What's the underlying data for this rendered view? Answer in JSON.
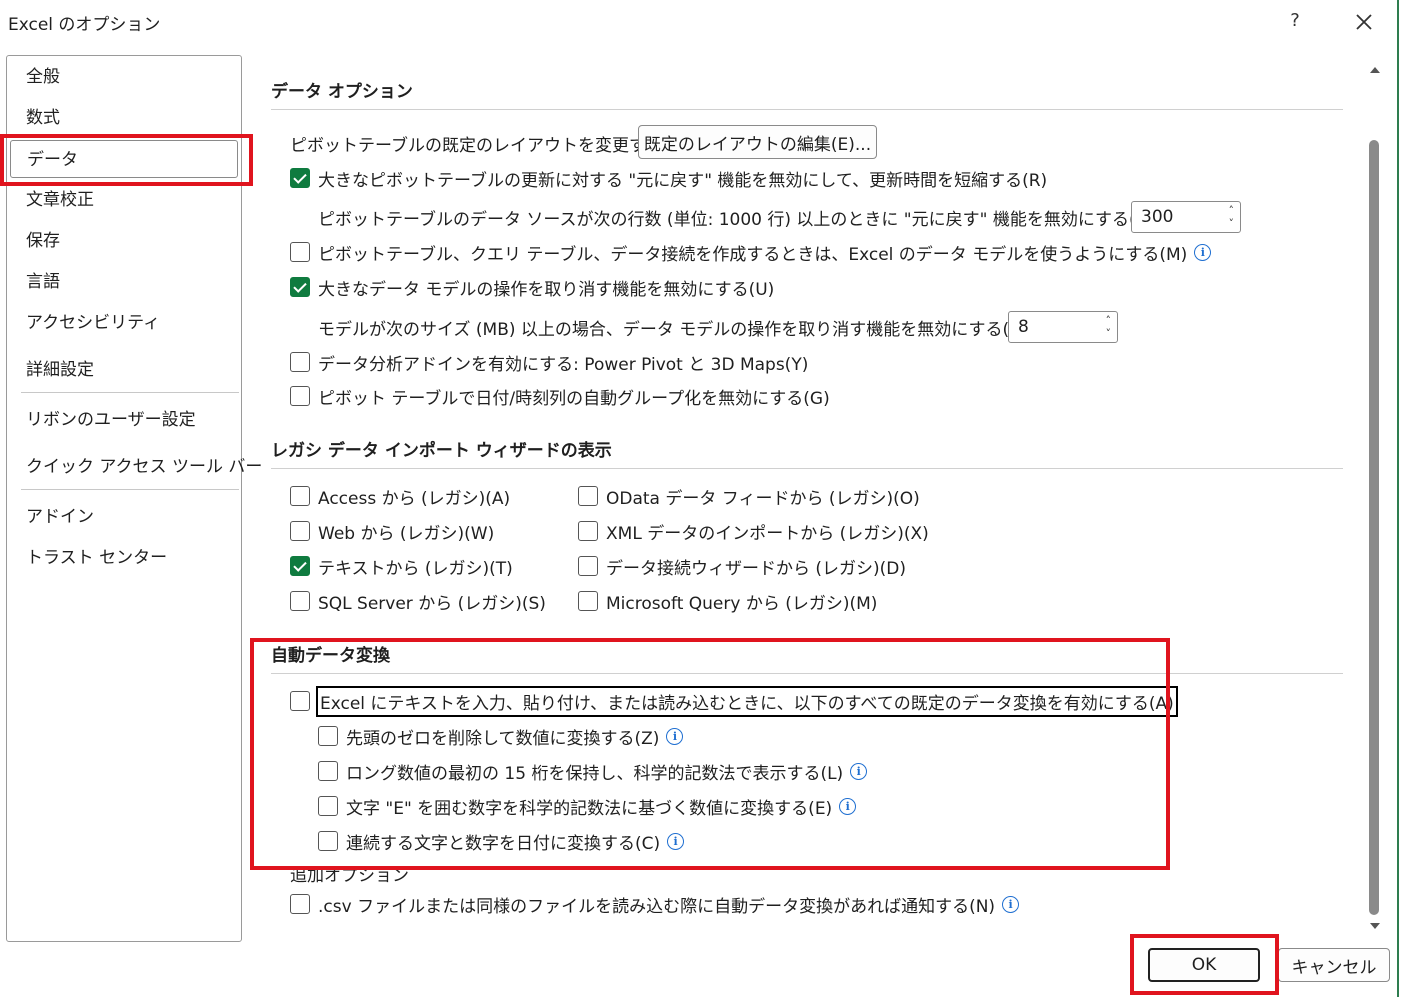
{
  "window": {
    "title": "Excel のオプション",
    "help": "?"
  },
  "sidebar": {
    "items": [
      {
        "label": "全般"
      },
      {
        "label": "数式"
      },
      {
        "label": "データ"
      },
      {
        "label": "文章校正"
      },
      {
        "label": "保存"
      },
      {
        "label": "言語"
      },
      {
        "label": "アクセシビリティ"
      },
      {
        "label": "詳細設定"
      },
      {
        "label": "リボンのユーザー設定"
      },
      {
        "label": "クイック アクセス ツール バー"
      },
      {
        "label": "アドイン"
      },
      {
        "label": "トラスト センター"
      }
    ],
    "selected": "データ"
  },
  "data_options": {
    "title": "データ オプション",
    "pivot_layout_label": "ピボットテーブルの既定のレイアウトを変更する:",
    "pivot_layout_button": "既定のレイアウトの編集(E)...",
    "undo_large_pivot": {
      "label": "大きなピボットテーブルの更新に対する \"元に戻す\" 機能を無効にして、更新時間を短縮する(R)",
      "checked": true
    },
    "undo_rows_label": "ピボットテーブルのデータ ソースが次の行数 (単位: 1000 行) 以上のときに \"元に戻す\" 機能を無効にする(N):",
    "undo_rows_value": "300",
    "use_data_model": {
      "label": "ピボットテーブル、クエリ テーブル、データ接続を作成するときは、Excel のデータ モデルを使うようにする(M)",
      "checked": false
    },
    "undo_large_model": {
      "label": "大きなデータ モデルの操作を取り消す機能を無効にする(U)",
      "checked": true
    },
    "model_size_label": "モデルが次のサイズ (MB) 以上の場合、データ モデルの操作を取り消す機能を無効にする(L):",
    "model_size_value": "8",
    "enable_addins": {
      "label": "データ分析アドインを有効にする: Power Pivot と 3D Maps(Y)",
      "checked": false
    },
    "disable_date_grouping": {
      "label": "ピボット テーブルで日付/時刻列の自動グループ化を無効にする(G)",
      "checked": false
    }
  },
  "legacy": {
    "title": "レガシ データ インポート ウィザードの表示",
    "items": [
      {
        "label": "Access から (レガシ)(A)",
        "checked": false
      },
      {
        "label": "Web から (レガシ)(W)",
        "checked": false
      },
      {
        "label": "テキストから (レガシ)(T)",
        "checked": true
      },
      {
        "label": "SQL Server から (レガシ)(S)",
        "checked": false
      },
      {
        "label": "OData データ フィードから (レガシ)(O)",
        "checked": false
      },
      {
        "label": "XML データのインポートから (レガシ)(X)",
        "checked": false
      },
      {
        "label": "データ接続ウィザードから (レガシ)(D)",
        "checked": false
      },
      {
        "label": "Microsoft Query から (レガシ)(M)",
        "checked": false
      }
    ]
  },
  "auto_convert": {
    "title": "自動データ変換",
    "main": {
      "label": "Excel にテキストを入力、貼り付け、または読み込むときに、以下のすべての既定のデータ変換を有効にする(A)",
      "checked": false
    },
    "subs": [
      {
        "label": "先頭のゼロを削除して数値に変換する(Z)",
        "checked": false
      },
      {
        "label": "ロング数値の最初の 15 桁を保持し、科学的記数法で表示する(L)",
        "checked": false
      },
      {
        "label": "文字 \"E\" を囲む数字を科学的記数法に基づく数値に変換する(E)",
        "checked": false
      },
      {
        "label": "連続する文字と数字を日付に変換する(C)",
        "checked": false
      }
    ],
    "extra_title": "追加オプション",
    "notify": {
      "label": ".csv ファイルまたは同様のファイルを読み込む際に自動データ変換があれば通知する(N)",
      "checked": false
    }
  },
  "footer": {
    "ok": "OK",
    "cancel": "キャンセル"
  },
  "colors": {
    "accent": "#0f7b3f",
    "highlight": "#e0141e",
    "info": "#1f6fd1"
  }
}
